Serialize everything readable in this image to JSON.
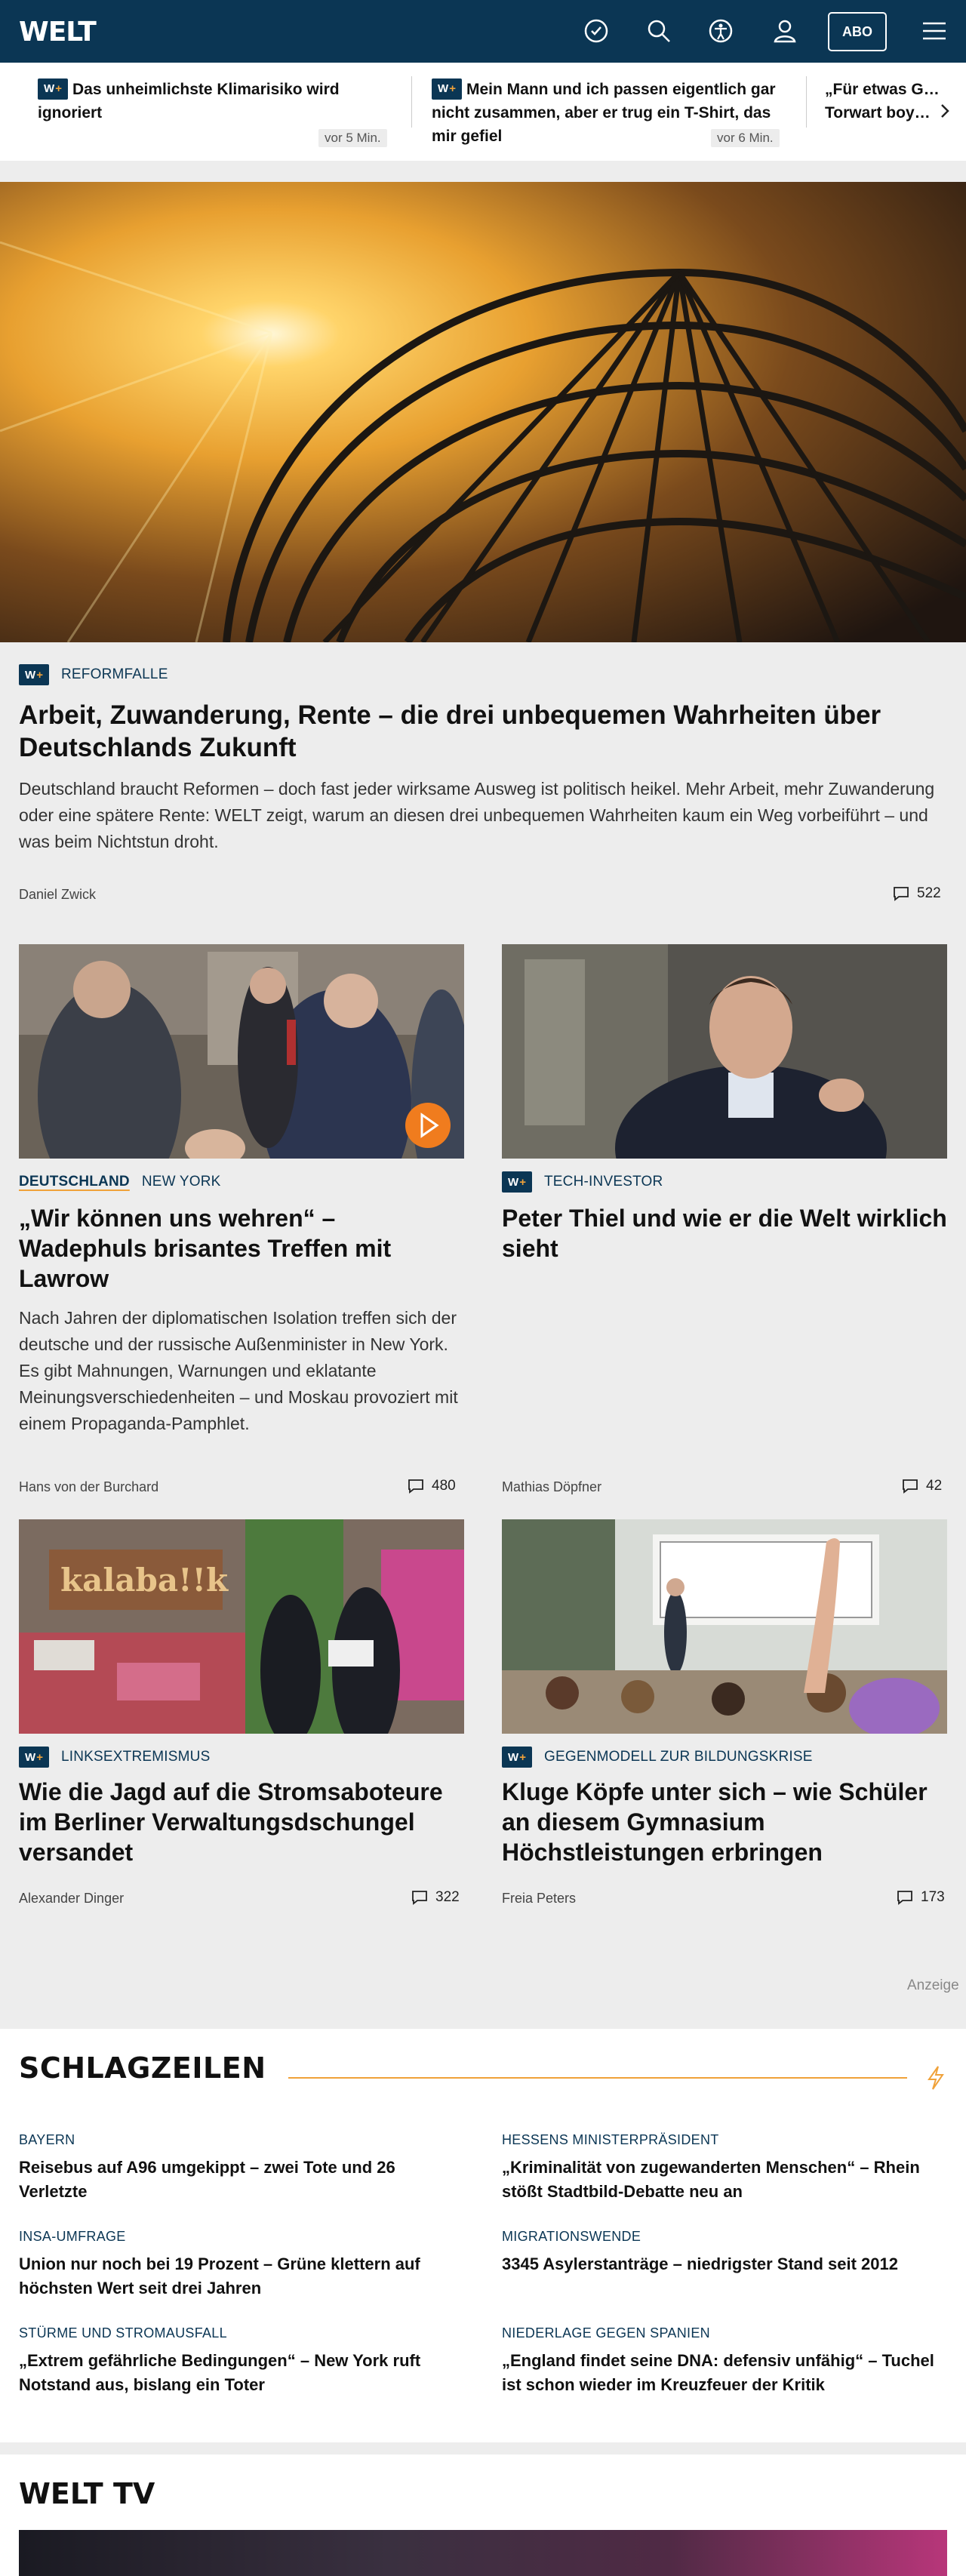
{
  "header": {
    "logo": "WELT",
    "abo_label": "ABO"
  },
  "ticker": [
    {
      "badge": "W+",
      "title": "Das unheimlichste Klimarisiko wird ignoriert",
      "time": "vor 5 Min."
    },
    {
      "badge": "W+",
      "title": "Mein Mann und ich passen eigentlich gar nicht zusammen, aber er trug ein T-Shirt, das mir gefiel",
      "time": "vor 6 Min."
    },
    {
      "badge": "",
      "title": "„Für etwas G… Torwart boy…",
      "time": ""
    }
  ],
  "hero": {
    "badge": "W+",
    "kicker": "REFORMFALLE",
    "title": "Arbeit, Zuwanderung, Rente – die drei unbequemen Wahrheiten über Deutschlands Zukunft",
    "lead": "Deutschland braucht Reformen – doch fast jeder wirksame Ausweg ist politisch heikel. Mehr Arbeit, mehr Zuwanderung oder eine spätere Rente: WELT zeigt, warum an diesen drei unbequemen Wahrheiten kaum ein Weg vorbeiführt – und was beim Nichtstun droht.",
    "author": "Daniel Zwick",
    "comments": "522"
  },
  "cards": [
    {
      "kicker_primary": "DEUTSCHLAND",
      "kicker": "NEW YORK",
      "badge": "",
      "title": "„Wir können uns wehren“ – Wadephuls brisantes Treffen mit Lawrow",
      "lead": "Nach Jahren der diplomatischen Isolation treffen sich der deutsche und der russische Außenminister in New York. Es gibt Mahnungen, Warnungen und eklatante Meinungsverschiedenheiten – und Moskau provoziert mit einem Propaganda-Pamphlet.",
      "author": "Hans von der Burchard",
      "comments": "480"
    },
    {
      "kicker_primary": "",
      "kicker": "TECH-INVESTOR",
      "badge": "W+",
      "title": "Peter Thiel und wie er die Welt wirklich sieht",
      "lead": "",
      "author": "Mathias Döpfner",
      "comments": "42"
    },
    {
      "kicker_primary": "",
      "kicker": "LINKSEXTREMISMUS",
      "badge": "W+",
      "title": "Wie die Jagd auf die Stromsaboteure im Berliner Verwaltungsdschungel versandet",
      "lead": "",
      "author": "Alexander Dinger",
      "comments": "322"
    },
    {
      "kicker_primary": "",
      "kicker": "GEGENMODELL ZUR BILDUNGSKRISE",
      "badge": "W+",
      "title": "Kluge Köpfe unter sich – wie Schüler an diesem Gymnasium Höchstleistungen erbringen",
      "lead": "",
      "author": "Freia Peters",
      "comments": "173"
    }
  ],
  "ad_label": "Anzeige",
  "schlagzeilen": {
    "title": "SCHLAGZEILEN",
    "items": [
      {
        "kicker": "BAYERN",
        "title": "Reisebus auf A96 umgekippt – zwei Tote und 26 Verletzte"
      },
      {
        "kicker": "HESSENS MINISTERPRÄSIDENT",
        "title": "„Kriminalität von zugewanderten Menschen“ – Rhein stößt Stadtbild-Debatte neu an"
      },
      {
        "kicker": "INSA-UMFRAGE",
        "title": "Union nur noch bei 19 Prozent – Grüne klettern auf höchsten Wert seit drei Jahren"
      },
      {
        "kicker": "MIGRATIONSWENDE",
        "title": "3345 Asylerstanträge – niedrigster Stand seit 2012"
      },
      {
        "kicker": "STÜRME UND STROMAUSFALL",
        "title": "„Extrem gefährliche Bedingungen“ – New York ruft Notstand aus, bislang ein Toter"
      },
      {
        "kicker": "NIEDERLAGE GEGEN SPANIEN",
        "title": "„England findet seine DNA: defensiv unfähig“ – Tuchel ist schon wieder im Kreuzfeuer der Kritik"
      }
    ]
  },
  "weltv": {
    "title": "WELT TV"
  },
  "colors": {
    "navy": "#0b3654",
    "accent": "#f0a23a",
    "background": "#ededed"
  }
}
